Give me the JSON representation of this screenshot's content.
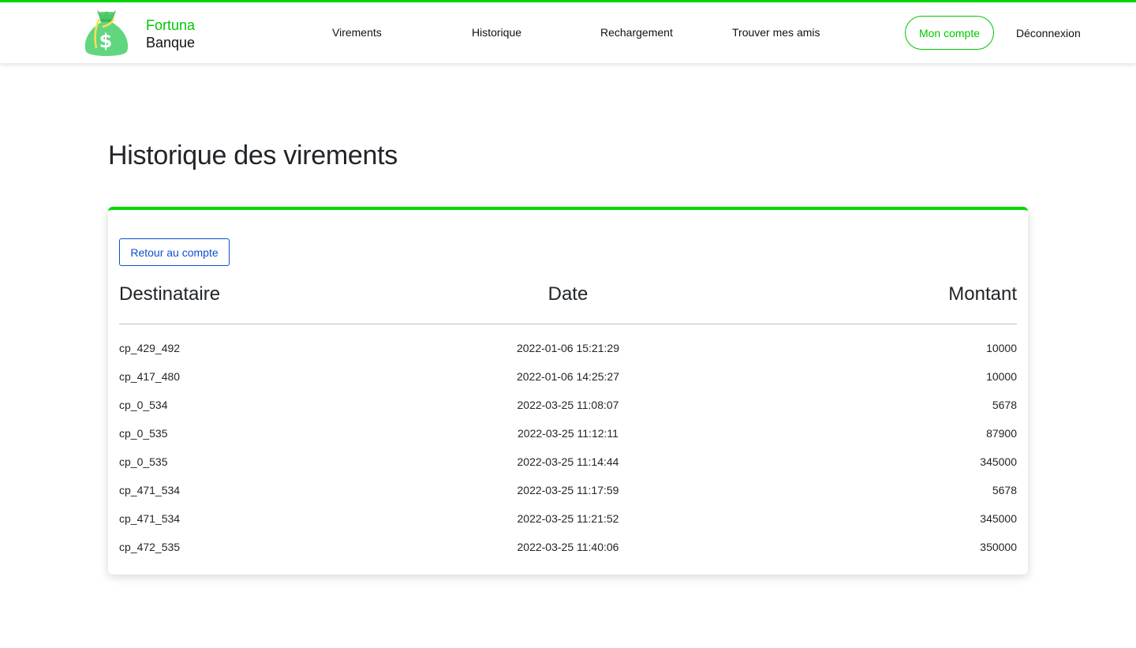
{
  "brand": {
    "line1": "Fortuna",
    "line2": "Banque",
    "accent": "#00d600",
    "logo_icon": "money-bag-dollar-icon"
  },
  "nav": {
    "transfers": "Virements",
    "history": "Historique",
    "recharge": "Rechargement",
    "find_friends": "Trouver mes amis",
    "account": "Mon compte",
    "logout": "Déconnexion"
  },
  "page": {
    "title": "Historique des virements"
  },
  "card": {
    "back_label": "Retour au compte"
  },
  "table": {
    "headers": [
      "Destinataire",
      "Date",
      "Montant"
    ],
    "rows": [
      [
        "cp_429_492",
        "2022-01-06 15:21:29",
        "10000"
      ],
      [
        "cp_417_480",
        "2022-01-06 14:25:27",
        "10000"
      ],
      [
        "cp_0_534",
        "2022-03-25 11:08:07",
        "5678"
      ],
      [
        "cp_0_535",
        "2022-03-25 11:12:11",
        "87900"
      ],
      [
        "cp_0_535",
        "2022-03-25 11:14:44",
        "345000"
      ],
      [
        "cp_471_534",
        "2022-03-25 11:17:59",
        "5678"
      ],
      [
        "cp_471_534",
        "2022-03-25 11:21:52",
        "345000"
      ],
      [
        "cp_472_535",
        "2022-03-25 11:40:06",
        "350000"
      ]
    ]
  }
}
